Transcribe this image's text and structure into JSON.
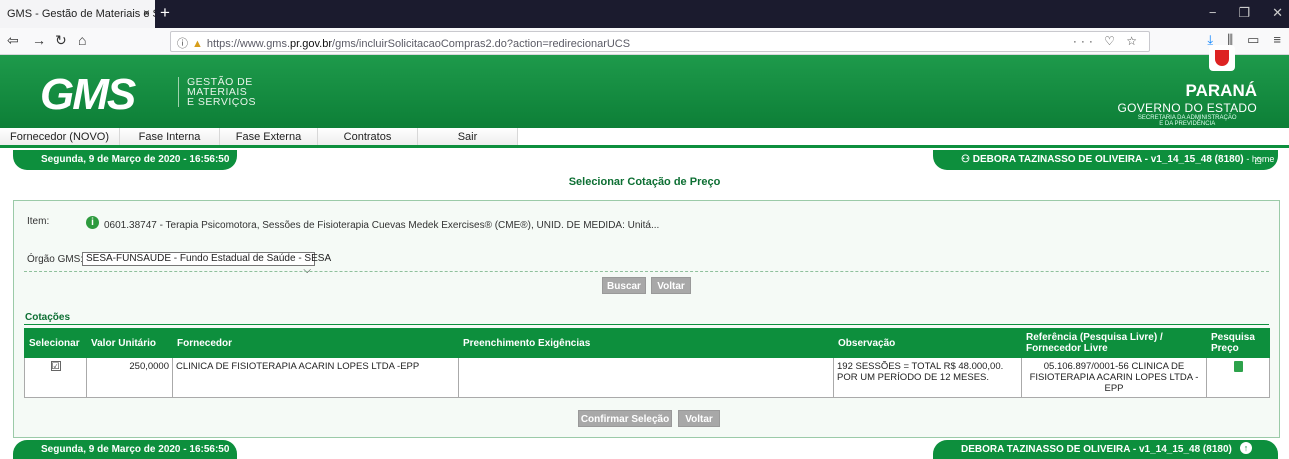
{
  "browser": {
    "tab_title": "GMS - Gestão de Materiais e Serviç",
    "tab_close": "×",
    "new_tab": "+",
    "url_prefix": "https://www.gms.",
    "url_domain": "pr.gov.br",
    "url_path": "/gms/incluirSolicitacaoCompras2.do?action=redirecionarUCS",
    "url_actions": "··· ♡ ☆",
    "win_min": "−",
    "win_max": "❐",
    "win_close": "✕"
  },
  "header": {
    "logo": "GMS",
    "sub_line1": "GESTÃO DE",
    "sub_line2": "MATERIAIS",
    "sub_line3": "E SERVIÇOS",
    "state_name": "PARANÁ",
    "state_gov": "GOVERNO DO ESTADO",
    "state_sec1": "SECRETARIA DA ADMINISTRAÇÃO",
    "state_sec2": "E DA PREVIDÊNCIA"
  },
  "menu": {
    "items": [
      "Fornecedor (NOVO)",
      "Fase Interna",
      "Fase Externa",
      "Contratos",
      "Sair"
    ]
  },
  "status": {
    "date": "Segunda, 9 de Março de 2020 - 16:56:50",
    "user": "DEBORA TAZINASSO DE OLIVEIRA - v1_14_15_48 (8180)",
    "home_link": "- home"
  },
  "page": {
    "title": "Selecionar Cotação de Preço"
  },
  "form": {
    "item_label": "Item:",
    "item_text": "0601.38747 - Terapia Psicomotora, Sessões de Fisioterapia Cuevas Medek Exercises® (CME®), UNID. DE MEDIDA: Unitá...",
    "orgao_label": "Órgão GMS:",
    "orgao_value": "SESA-FUNSAUDE - Fundo Estadual de Saúde - SESA",
    "buscar_label": "Buscar",
    "voltar_label": "Voltar"
  },
  "cotacoes": {
    "section_label": "Cotações",
    "headers": {
      "selecionar": "Selecionar",
      "valor": "Valor Unitário",
      "fornecedor": "Fornecedor",
      "exigencias": "Preenchimento Exigências",
      "observacao": "Observação",
      "referencia_1": "Referência (Pesquisa Livre) /",
      "referencia_2": "Fornecedor Livre",
      "pesquisa_1": "Pesquisa",
      "pesquisa_2": "Preço"
    },
    "rows": [
      {
        "checked": "☑",
        "valor": "250,0000",
        "fornecedor": "CLINICA DE FISIOTERAPIA ACARIN LOPES LTDA -EPP",
        "exigencias": "",
        "observacao": "192 SESSÕES = TOTAL R$ 48.000,00. POR UM PERÍODO DE 12 MESES.",
        "referencia": "05.106.897/0001-56 CLINICA DE FISIOTERAPIA ACARIN LOPES LTDA -EPP"
      }
    ],
    "confirm_label": "Confirmar Seleção",
    "voltar_label": "Voltar"
  }
}
